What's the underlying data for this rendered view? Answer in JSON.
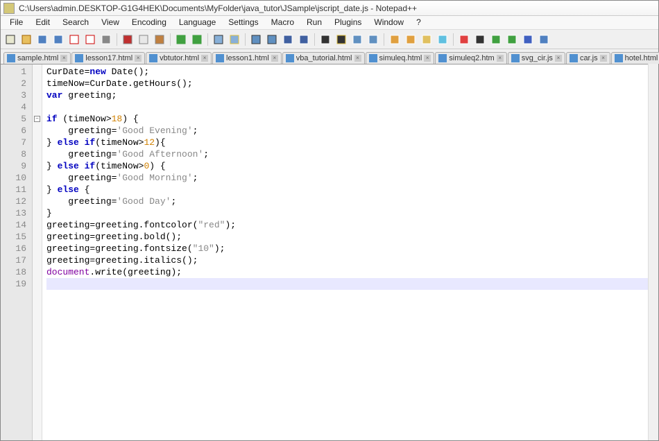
{
  "title": "C:\\Users\\admin.DESKTOP-G1G4HEK\\Documents\\MyFolder\\java_tutor\\JSample\\jscript_date.js - Notepad++",
  "menus": [
    "File",
    "Edit",
    "Search",
    "View",
    "Encoding",
    "Language",
    "Settings",
    "Macro",
    "Run",
    "Plugins",
    "Window",
    "?"
  ],
  "tabs": [
    "sample.html",
    "lesson17.html",
    "vbtutor.html",
    "lesson1.html",
    "vba_tutorial.html",
    "simuleq.html",
    "simuleq2.htm",
    "svg_cir.js",
    "car.js",
    "hotel.html"
  ],
  "code": {
    "lines": [
      {
        "n": 1,
        "html": "CurDate=<span class='kw-blue'>new</span> Date();"
      },
      {
        "n": 2,
        "html": "timeNow=CurDate.getHours();"
      },
      {
        "n": 3,
        "html": "<span class='kw-blue'>var</span> greeting;"
      },
      {
        "n": 4,
        "html": ""
      },
      {
        "n": 5,
        "html": "<span class='kw-blue'>if</span> (timeNow&gt;<span class='num-orange'>18</span>) {"
      },
      {
        "n": 6,
        "html": "    greeting=<span class='str-grey'>'Good Evening'</span>;"
      },
      {
        "n": 7,
        "html": "} <span class='kw-blue'>else if</span>(timeNow&gt;<span class='num-orange'>12</span>){"
      },
      {
        "n": 8,
        "html": "    greeting=<span class='str-grey'>'Good Afternoon'</span>;"
      },
      {
        "n": 9,
        "html": "} <span class='kw-blue'>else if</span>(timeNow&gt;<span class='num-orange'>0</span>) {"
      },
      {
        "n": 10,
        "html": "    greeting=<span class='str-grey'>'Good Morning'</span>;"
      },
      {
        "n": 11,
        "html": "} <span class='kw-blue'>else</span> {"
      },
      {
        "n": 12,
        "html": "    greeting=<span class='str-grey'>'Good Day'</span>;"
      },
      {
        "n": 13,
        "html": "}"
      },
      {
        "n": 14,
        "html": "greeting=greeting.fontcolor(<span class='str-grey'>\"red\"</span>);"
      },
      {
        "n": 15,
        "html": "greeting=greeting.bold();"
      },
      {
        "n": 16,
        "html": "greeting=greeting.fontsize(<span class='str-grey'>\"10\"</span>);"
      },
      {
        "n": 17,
        "html": "greeting=greeting.italics();"
      },
      {
        "n": 18,
        "html": "<span class='op-purple'>document</span>.write(greeting);"
      },
      {
        "n": 19,
        "html": "",
        "current": true
      }
    ]
  }
}
